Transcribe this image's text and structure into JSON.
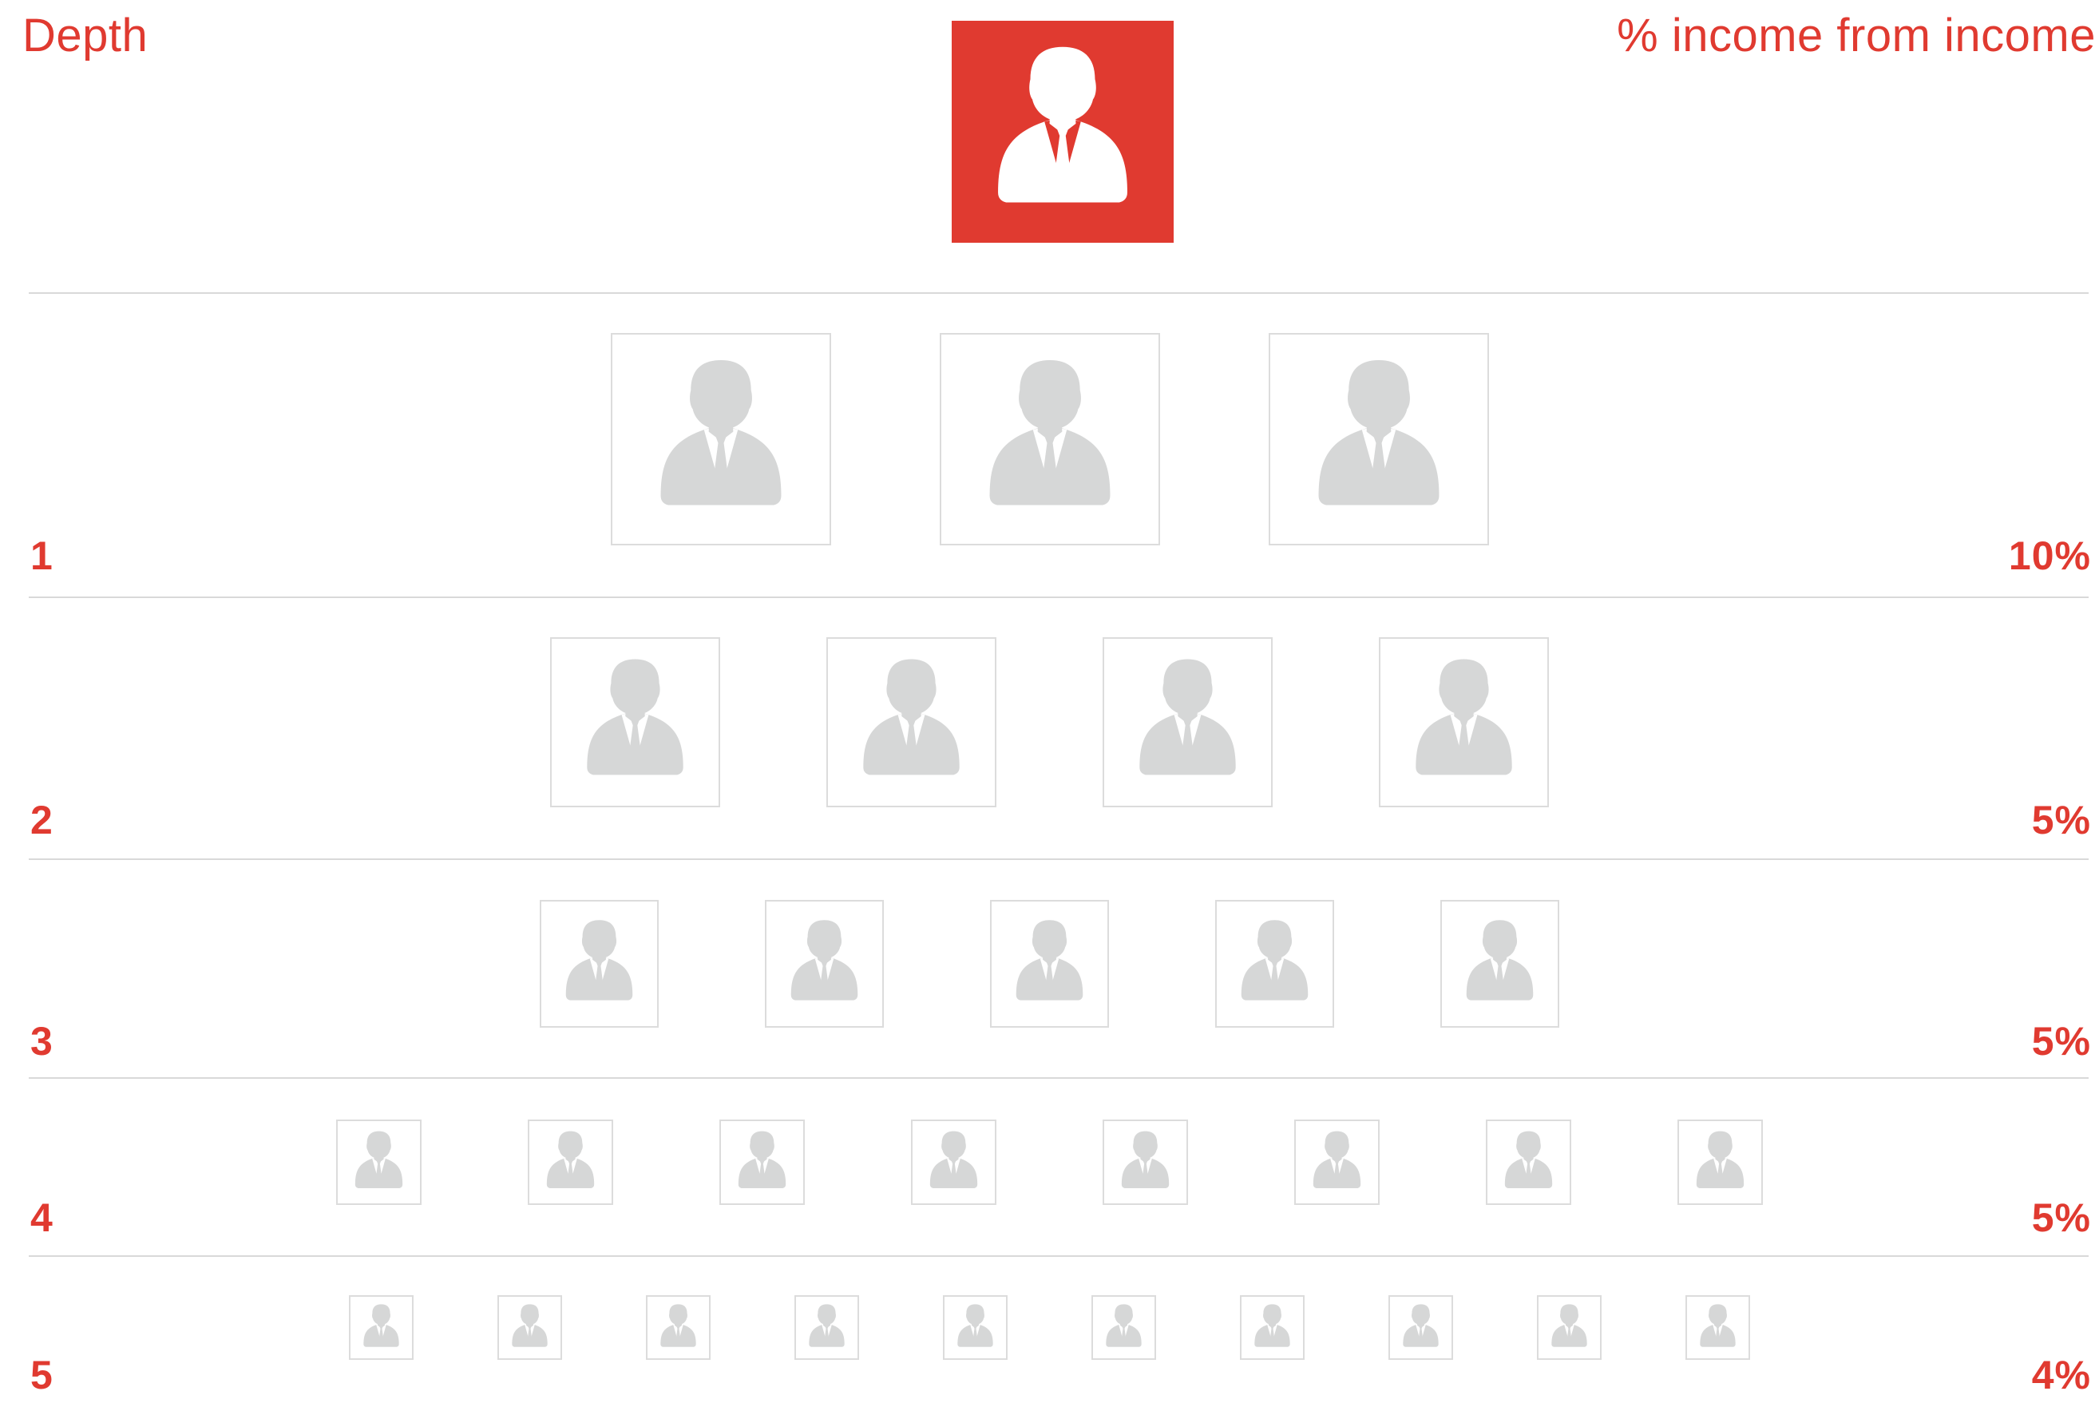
{
  "header": {
    "depth_label": "Depth",
    "income_label": "% income from income"
  },
  "colors": {
    "accent": "#e03a30",
    "person_gray": "#d6d7d7",
    "card_border": "#dcdcdc",
    "divider": "#d9d9d9"
  },
  "icons": {
    "root": "person-icon",
    "member": "person-icon"
  },
  "levels": [
    {
      "depth": "1",
      "percent": "10%",
      "members": 3
    },
    {
      "depth": "2",
      "percent": "5%",
      "members": 4
    },
    {
      "depth": "3",
      "percent": "5%",
      "members": 5
    },
    {
      "depth": "4",
      "percent": "5%",
      "members": 8
    },
    {
      "depth": "5",
      "percent": "4%",
      "members": 10
    }
  ]
}
